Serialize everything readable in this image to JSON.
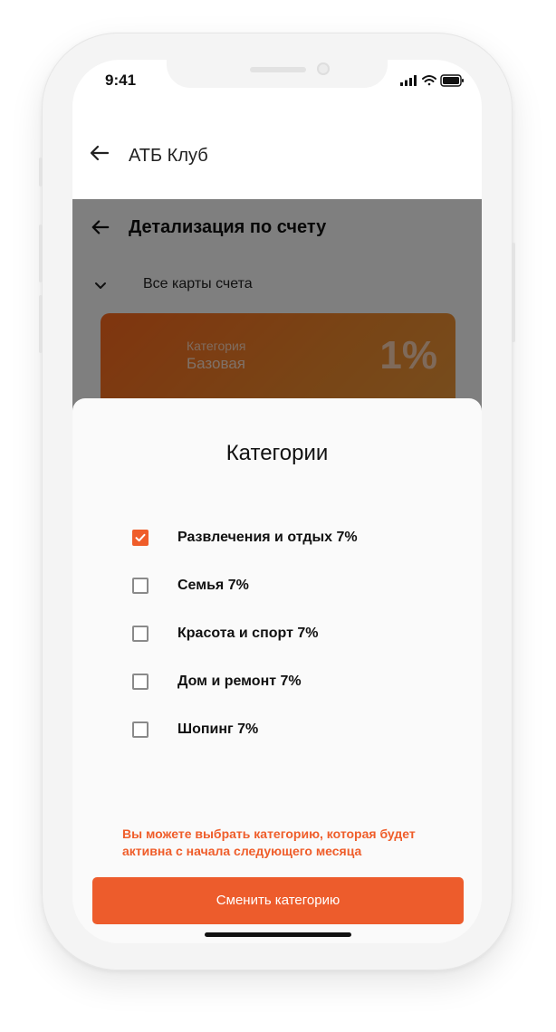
{
  "status": {
    "time": "9:41"
  },
  "appbar": {
    "title": "АТБ Клуб"
  },
  "background": {
    "title": "Детализация по счету",
    "cards_filter": "Все карты счета",
    "card": {
      "label": "Категория",
      "value": "Базовая",
      "percent": "1%"
    }
  },
  "sheet": {
    "title": "Категории",
    "options": [
      {
        "label": "Развлечения и отдых 7%",
        "checked": true
      },
      {
        "label": "Семья 7%",
        "checked": false
      },
      {
        "label": "Красота и спорт 7%",
        "checked": false
      },
      {
        "label": "Дом и ремонт 7%",
        "checked": false
      },
      {
        "label": "Шопинг 7%",
        "checked": false
      }
    ],
    "hint": "Вы можете выбрать категорию, которая будет активна с начала следующего месяца",
    "button_label": "Сменить категорию"
  },
  "colors": {
    "accent": "#ed5c2c",
    "hint": "#ef5d2a",
    "overlay": "rgba(0,0,0,0.5)"
  }
}
